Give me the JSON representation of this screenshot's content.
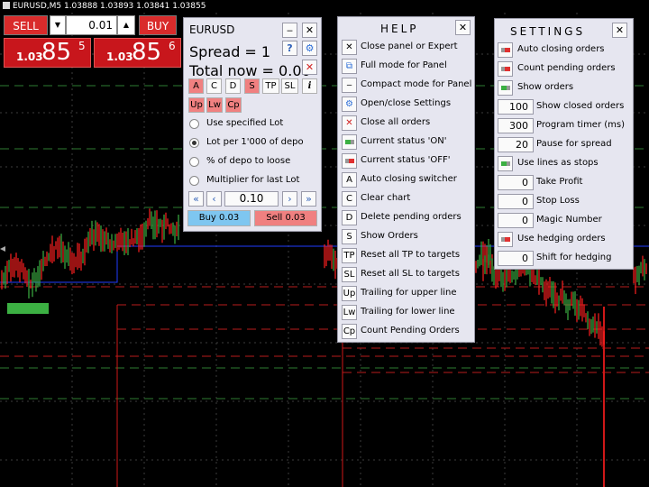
{
  "chart": {
    "symbol_title": "EURUSD,M5  1.03888 1.03893 1.03841 1.03855",
    "colors": {
      "background": "#000000",
      "bull": "#3cb043",
      "bear": "#ff2020",
      "grid": "#3c3c3c",
      "green_dash": "#2e7d32",
      "red_dash": "#b71c1c",
      "blue_line": "#1f3cff"
    }
  },
  "one_click": {
    "sell_label": "SELL",
    "buy_label": "BUY",
    "volume": "0.01",
    "sell_price": {
      "prefix": "1.03",
      "big": "85",
      "sup": "5"
    },
    "buy_price": {
      "prefix": "1.03",
      "big": "85",
      "sup": "6"
    }
  },
  "main_panel": {
    "title": "EURUSD",
    "spread": "Spread = 1",
    "total": "Total now = 0.00",
    "mode_buttons": [
      "A",
      "C",
      "D",
      "S",
      "TP",
      "SL"
    ],
    "info_icon": "i",
    "line_buttons": [
      "Up",
      "Lw",
      "Cp"
    ],
    "lot_options": [
      {
        "label": "Use specified Lot",
        "selected": false
      },
      {
        "label": "Lot per 1'000 of depo",
        "selected": true
      },
      {
        "label": "% of depo to loose",
        "selected": false
      },
      {
        "label": "Multiplier for last Lot",
        "selected": false
      }
    ],
    "lot_value": "0.10",
    "buy_label": "Buy 0.03",
    "sell_label": "Sell 0.03"
  },
  "help_panel": {
    "title": "HELP",
    "items": [
      {
        "icon": "✕",
        "label": "Close panel or Expert"
      },
      {
        "icon": "⧉",
        "label": "Full mode for Panel"
      },
      {
        "icon": "‒",
        "label": "Compact mode for Panel"
      },
      {
        "icon": "⚙",
        "label": "Open/close Settings"
      },
      {
        "icon": "✕",
        "label": "Close all orders"
      },
      {
        "icon": "on",
        "label": "Current status 'ON'"
      },
      {
        "icon": "off",
        "label": "Current status 'OFF'"
      },
      {
        "icon": "A",
        "label": "Auto closing switcher"
      },
      {
        "icon": "C",
        "label": "Clear chart"
      },
      {
        "icon": "D",
        "label": "Delete pending orders"
      },
      {
        "icon": "S",
        "label": "Show Orders"
      },
      {
        "icon": "TP",
        "label": "Reset all TP to targets"
      },
      {
        "icon": "SL",
        "label": "Reset all SL to targets"
      },
      {
        "icon": "Up",
        "label": "Trailing for upper line"
      },
      {
        "icon": "Lw",
        "label": "Trailing for lower line"
      },
      {
        "icon": "Cp",
        "label": "Count Pending Orders"
      }
    ]
  },
  "settings_panel": {
    "title": "SETTINGS",
    "items": [
      {
        "kind": "toggle",
        "state": "off",
        "label": "Auto closing orders"
      },
      {
        "kind": "toggle",
        "state": "off",
        "label": "Count pending orders"
      },
      {
        "kind": "toggle",
        "state": "on",
        "label": "Show orders"
      },
      {
        "kind": "value",
        "value": "100",
        "label": "Show closed orders"
      },
      {
        "kind": "value",
        "value": "300",
        "label": "Program timer (ms)"
      },
      {
        "kind": "value",
        "value": "20",
        "label": "Pause for spread"
      },
      {
        "kind": "toggle",
        "state": "on",
        "label": "Use lines as stops"
      },
      {
        "kind": "value",
        "value": "0",
        "label": "Take Profit"
      },
      {
        "kind": "value",
        "value": "0",
        "label": "Stop Loss"
      },
      {
        "kind": "value",
        "value": "0",
        "label": "Magic Number"
      },
      {
        "kind": "toggle",
        "state": "off",
        "label": "Use hedging orders"
      },
      {
        "kind": "value",
        "value": "0",
        "label": "Shift for hedging"
      }
    ]
  }
}
